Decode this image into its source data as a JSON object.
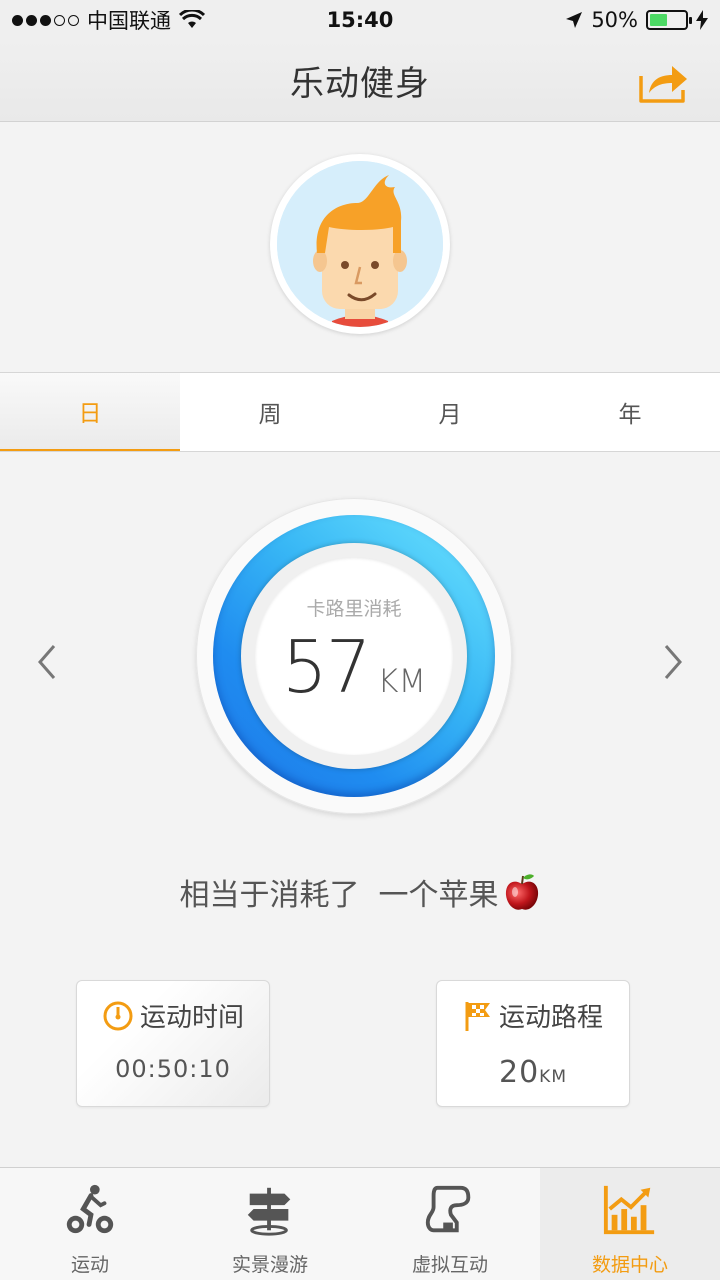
{
  "status_bar": {
    "carrier": "中国联通",
    "time": "15:40",
    "battery_percent": "50%",
    "battery_level": 0.5,
    "signal_strength": 3,
    "signal_max": 5
  },
  "nav": {
    "title": "乐动健身",
    "share_icon": "share-icon"
  },
  "tabs": [
    {
      "label": "日",
      "active": true
    },
    {
      "label": "周",
      "active": false
    },
    {
      "label": "月",
      "active": false
    },
    {
      "label": "年",
      "active": false
    }
  ],
  "ring": {
    "label": "卡路里消耗",
    "value": "57",
    "unit": "KM"
  },
  "equivalent": {
    "text": "相当于消耗了  一个苹果",
    "icon": "apple-icon"
  },
  "cards": {
    "time": {
      "label": "运动时间",
      "value": "00:50:10",
      "icon": "clock-icon"
    },
    "distance": {
      "label": "运动路程",
      "value": "20",
      "unit": "KM",
      "icon": "flag-icon"
    }
  },
  "tab_bar": [
    {
      "label": "运动",
      "icon": "cyclist-icon",
      "active": false
    },
    {
      "label": "实景漫游",
      "icon": "signpost-icon",
      "active": false
    },
    {
      "label": "虚拟互动",
      "icon": "track-icon",
      "active": false
    },
    {
      "label": "数据中心",
      "icon": "chart-icon",
      "active": true
    }
  ],
  "colors": {
    "accent": "#f39c12",
    "ring_start": "#6ee6ff",
    "ring_end": "#1e78e8"
  }
}
